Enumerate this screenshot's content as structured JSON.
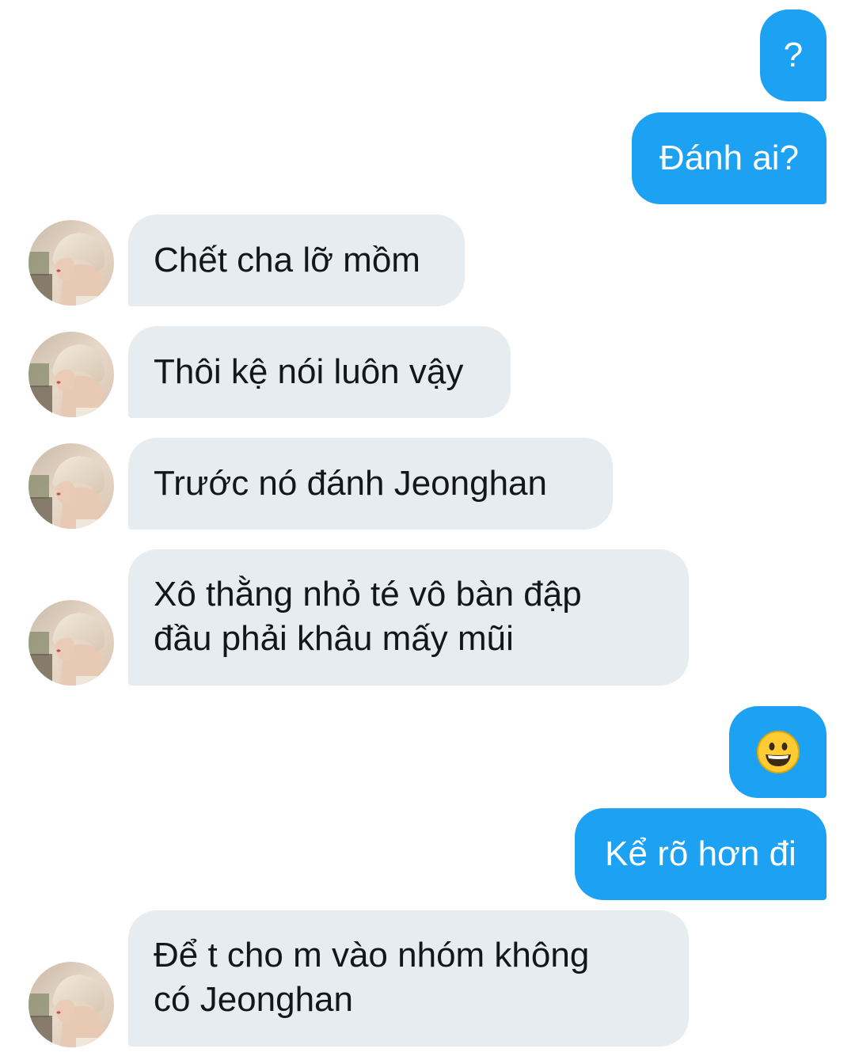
{
  "thread": {
    "messages": [
      {
        "side": "sent",
        "text": "?"
      },
      {
        "side": "sent",
        "text": "Đánh ai?"
      },
      {
        "side": "received",
        "text": "Chết cha lỡ mồm"
      },
      {
        "side": "received",
        "text": "Thôi kệ nói luôn vậy"
      },
      {
        "side": "received",
        "text": "Trước nó đánh Jeonghan"
      },
      {
        "side": "received",
        "lines": [
          "Xô thằng nhỏ té vô bàn đập",
          "đầu phải khâu mấy mũi"
        ]
      },
      {
        "side": "sent",
        "emoji": "grinning-face"
      },
      {
        "side": "sent",
        "text": "Kể rõ hơn đi"
      },
      {
        "side": "received",
        "lines": [
          "Để t cho m vào nhóm không",
          "có Jeonghan"
        ]
      }
    ]
  },
  "colors": {
    "sent_bubble": "#1da1f2",
    "received_bubble": "#e6ecf0",
    "received_text": "#14171a",
    "sent_text": "#ffffff"
  },
  "icons": {
    "avatar": "avatar-photo-icon",
    "emoji": "grinning-face-emoji-icon"
  }
}
